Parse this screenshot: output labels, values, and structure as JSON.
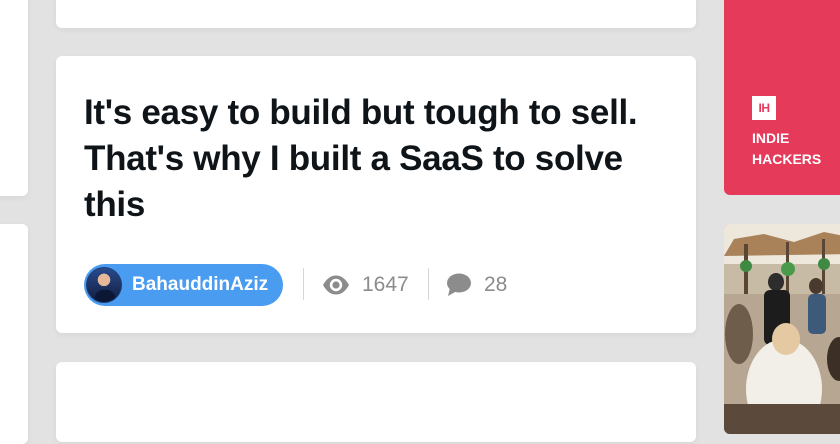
{
  "post": {
    "title": "It's easy to build but tough to sell. That's why I built a SaaS to solve this",
    "author": "BahauddinAziz",
    "views": "1647",
    "comments": "28"
  },
  "icons": {
    "views": "eye-icon",
    "comments": "speech-bubble-icon",
    "brand": "indie-hackers-logo"
  },
  "sidebar": {
    "brand_logo_text": "IH",
    "brand_text": "INDIE HACKERS"
  },
  "colors": {
    "background": "#e2e2e2",
    "card": "#ffffff",
    "author_pill": "#4a9cf0",
    "indie_hackers_red": "#e63a5b",
    "stat_gray": "#8c8c8c",
    "title": "#0f1419"
  }
}
